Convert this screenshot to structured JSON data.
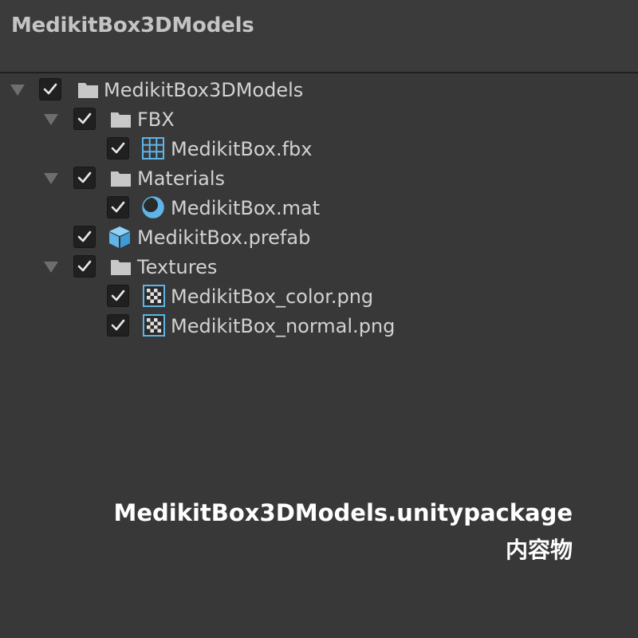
{
  "window": {
    "title": "MedikitBox3DModels"
  },
  "tree": {
    "items": [
      {
        "label": "MedikitBox3DModels",
        "icon": "folder-icon",
        "checked": true,
        "expanded": true,
        "depth": 0
      },
      {
        "label": "FBX",
        "icon": "folder-icon",
        "checked": true,
        "expanded": true,
        "depth": 1
      },
      {
        "label": "MedikitBox.fbx",
        "icon": "mesh-grid-icon",
        "checked": true,
        "depth": 2
      },
      {
        "label": "Materials",
        "icon": "folder-icon",
        "checked": true,
        "expanded": true,
        "depth": 1
      },
      {
        "label": "MedikitBox.mat",
        "icon": "material-sphere-icon",
        "checked": true,
        "depth": 2
      },
      {
        "label": "MedikitBox.prefab",
        "icon": "prefab-cube-icon",
        "checked": true,
        "depth": 1
      },
      {
        "label": "Textures",
        "icon": "folder-icon",
        "checked": true,
        "expanded": true,
        "depth": 1
      },
      {
        "label": "MedikitBox_color.png",
        "icon": "texture-icon",
        "checked": true,
        "depth": 2
      },
      {
        "label": "MedikitBox_normal.png",
        "icon": "texture-icon",
        "checked": true,
        "depth": 2
      }
    ]
  },
  "caption": {
    "line1": "MedikitBox3DModels.unitypackage",
    "line2": "内容物"
  },
  "colors": {
    "background": "#383838",
    "header": "#3b3b3b",
    "text": "#d2d2d2",
    "accent_blue": "#5fb4e8",
    "folder": "#c8c8c8"
  }
}
